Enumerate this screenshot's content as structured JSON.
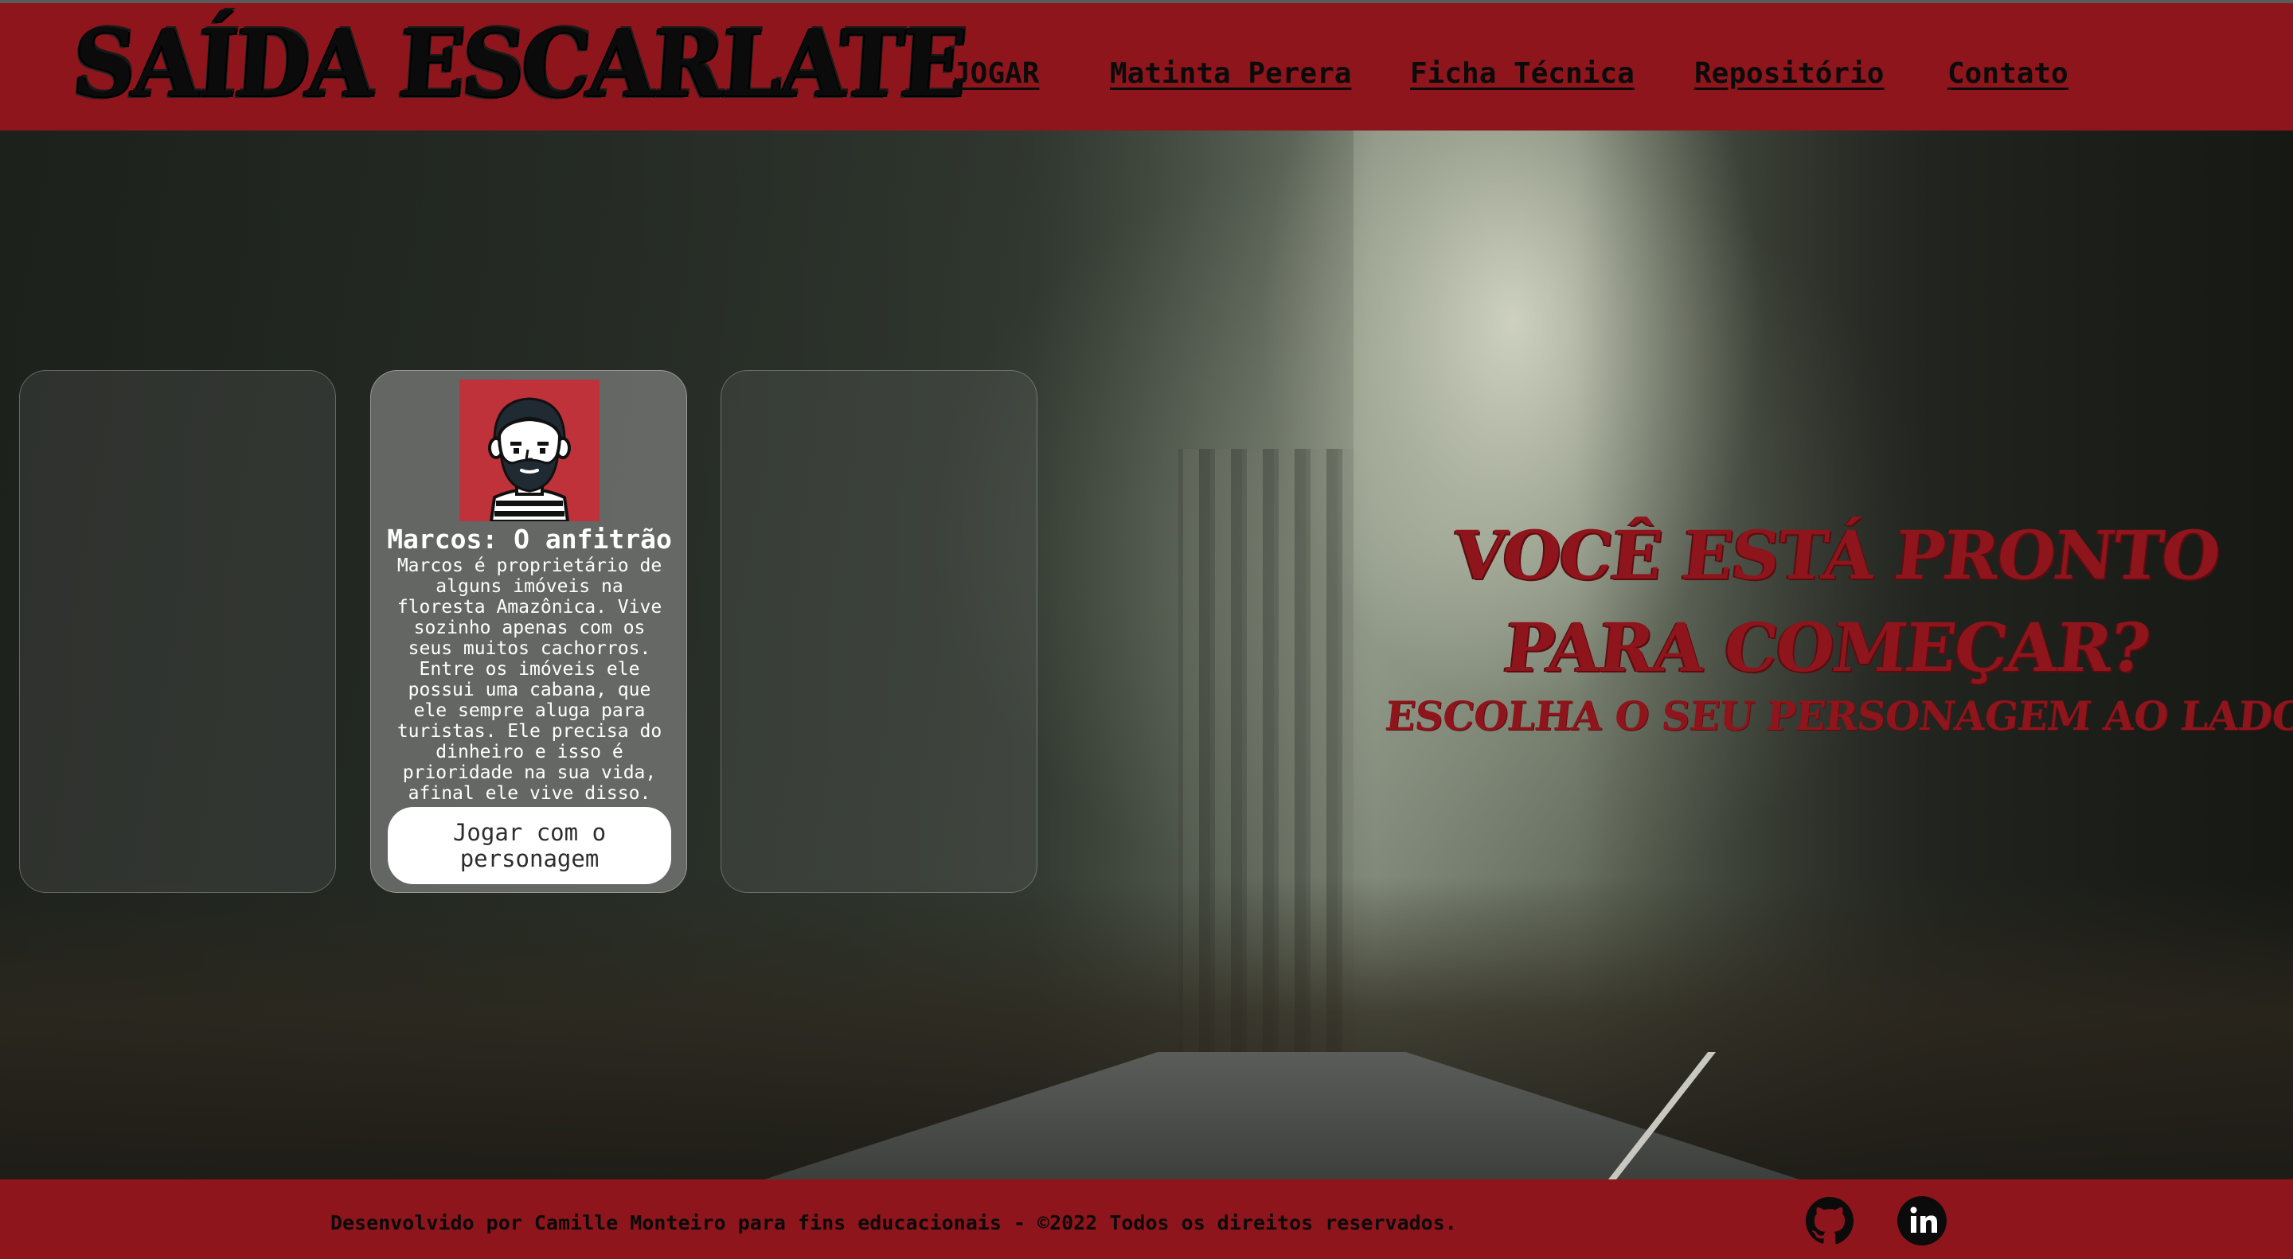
{
  "header": {
    "logo": "SAÍDA ESCARLATE",
    "nav": {
      "jogar": "JOGAR",
      "matinta": "Matinta Perera",
      "ficha": "Ficha Técnica",
      "repositorio": "Repositório",
      "contato": "Contato"
    }
  },
  "cards": {
    "selected": {
      "title": "Marcos: O anfitrão",
      "description": "Marcos é proprietário de alguns imóveis na floresta Amazônica. Vive sozinho apenas com os seus muitos cachorros. Entre os imóveis ele possui uma cabana, que ele sempre aluga para turistas. Ele precisa do dinheiro e isso é prioridade na sua vida, afinal ele vive disso.",
      "button": "Jogar com o personagem",
      "avatar_icon": "bearded-man-avatar-icon"
    }
  },
  "hero": {
    "title": "VOCÊ ESTÁ PRONTO PARA COMEÇAR?",
    "subtitle": "ESCOLHA O SEU PERSONAGEM AO LADO:"
  },
  "footer": {
    "text": "Desenvolvido por Camille Monteiro para fins educacionais - ©2022 Todos os direitos reservados.",
    "icons": [
      "github-icon",
      "linkedin-icon"
    ]
  },
  "colors": {
    "brand_red": "#8e151b",
    "avatar_bg": "#bf323a",
    "text_dark": "#0b0b0b"
  }
}
